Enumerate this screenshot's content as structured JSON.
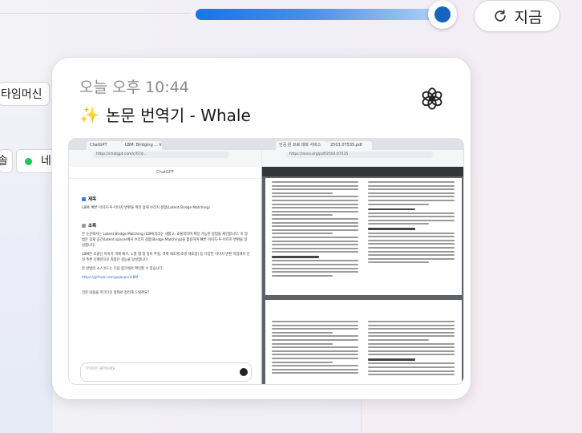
{
  "timeline": {
    "slider_level": 0.98,
    "now_button_label": "지금",
    "accent_color": "#1565c0"
  },
  "side": {
    "chip_time_machine": "타임머신",
    "chip_a": "솔",
    "chip_b": "네이"
  },
  "card": {
    "time": "오늘 오후 10:44",
    "title": "논문 번역기 - Whale",
    "sparkle_icon": "sparkle-icon",
    "app_icon": "openai-icon"
  },
  "thumbnail": {
    "tabs": [
      "ChatGPT",
      "LBM: Bridging ... Image...",
      "",
      "인공 원 프로 대화 서비스",
      "2503.07535.pdf"
    ],
    "urls": [
      "https://chatgpt.com/c/67d...",
      "https://arxiv.org/pdf/2503.07535"
    ],
    "chat_header": "ChatGPT",
    "sections": [
      {
        "title": "제목",
        "text": "LBM: 빠른 이미지-투-이미지 변환을 위한 잠재 브리지 정합(Latent Bridge Matching)"
      },
      {
        "title": "초록",
        "text": "본 논문에서는 Latent Bridge Matching (LBM)이라는 새롭고, 효율적이며 확장 가능한 방법을 제안합니다. 이 방법은 잠재 공간(latent space)에서 브리지 정합(Bridge Matching)을 활용하여 빠른 이미지-투-이미지 변환을 달성합니다."
      },
      {
        "title": "",
        "text": "LBM은 초광선 이미지 객체 제거, 노멀 맵 및 깊이 추정, 객체 재조명(조명 재조정) 등 다양한 이미지 변환 작업에서 단일 추론 단계만으로 최첨단 성능을 달성합니다."
      },
      {
        "title": "",
        "text": "본 방법의 소스코드는 다음 링크에서 확인할 수 있습니다:"
      }
    ],
    "link": "https://github.com/gojasper/LBM",
    "footer_text": "전문 내용을 마크다운 형태로 정리해 드릴까요?",
    "input_placeholder": "무엇이든 물어보세요"
  }
}
